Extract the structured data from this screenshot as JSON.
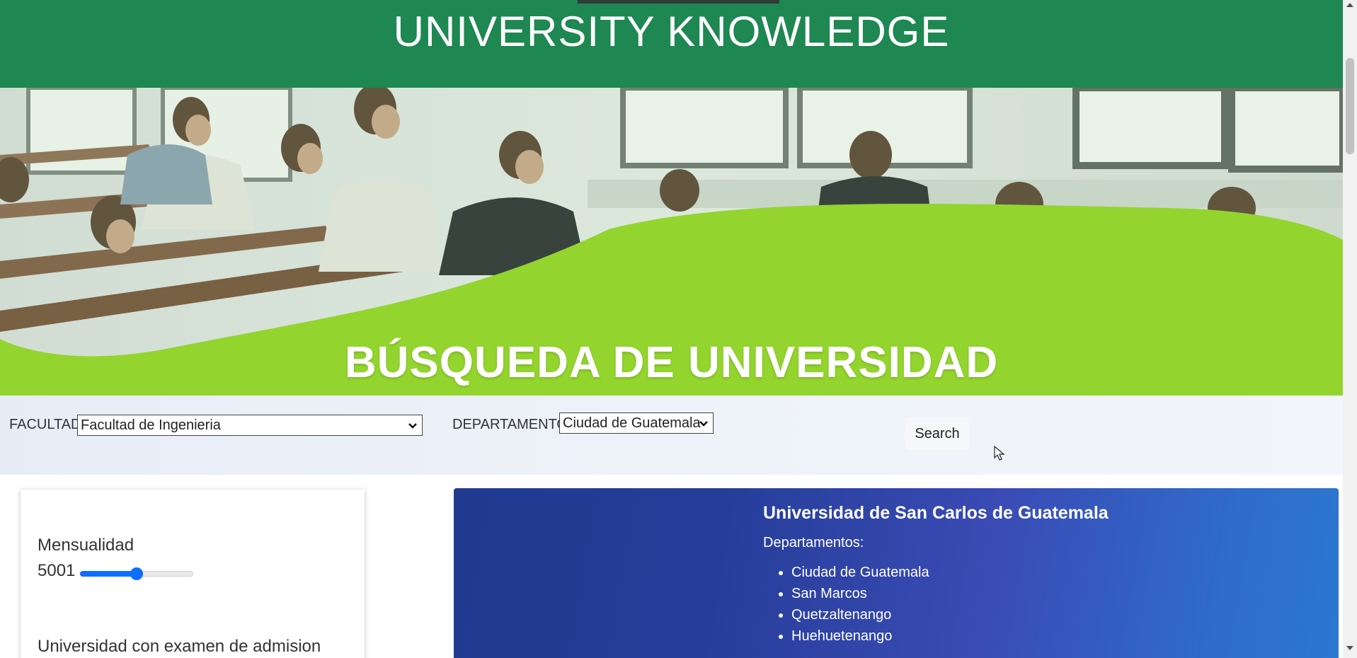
{
  "header": {
    "title": "UNIVERSITY KNOWLEDGE"
  },
  "hero": {
    "title": "BÚSQUEDA DE UNIVERSIDAD"
  },
  "search": {
    "facultad_label": "FACULTAD",
    "facultad_value": "Facultad de Ingenieria",
    "departamento_label": "DEPARTAMENTO",
    "departamento_value": "Ciudad de Guatemala",
    "search_button": "Search"
  },
  "filters": {
    "mensualidad_label": "Mensualidad",
    "mensualidad_value": "5001",
    "mensualidad_level": 0.5,
    "admision_label": "Universidad con examen de admision"
  },
  "result": {
    "title": "Universidad de San Carlos de Guatemala",
    "departamentos_label": "Departamentos:",
    "departamentos": [
      "Ciudad de Guatemala",
      "San Marcos",
      "Quetzaltenango",
      "Huehuetenango"
    ]
  },
  "colors": {
    "header_green": "#1e8752",
    "hero_green": "#93d42e",
    "slider_blue": "#0d6efd",
    "card_blue_start": "#1f3a8f",
    "card_blue_end": "#2c78d0"
  }
}
